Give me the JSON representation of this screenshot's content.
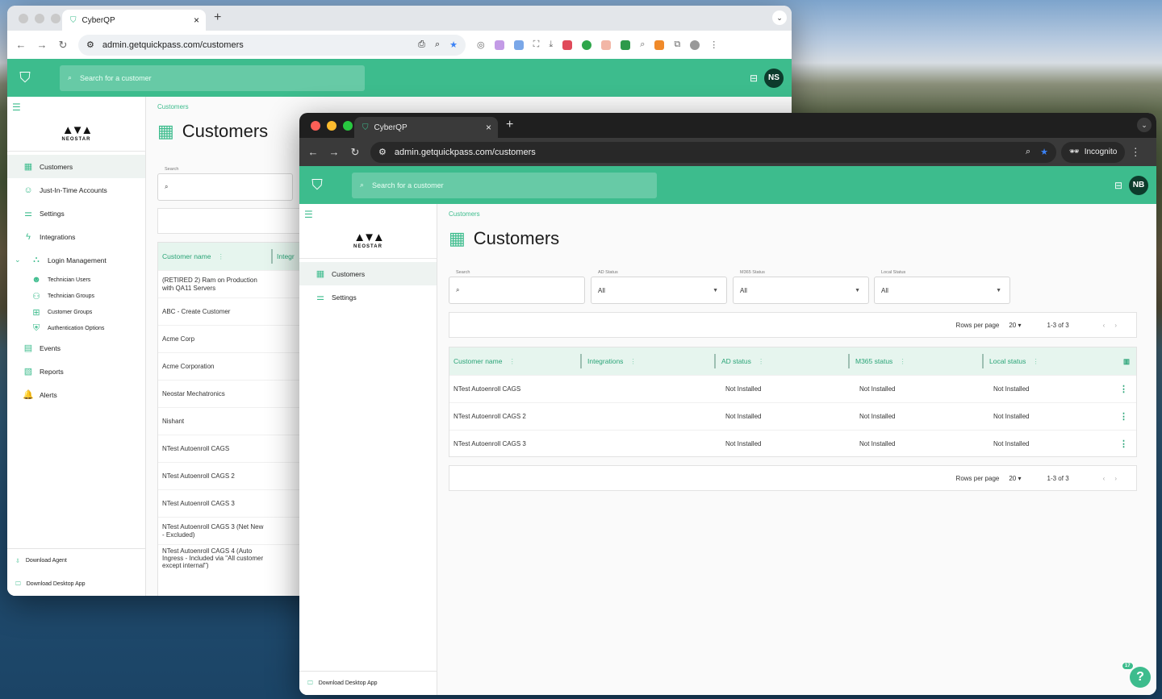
{
  "back_window": {
    "tab_title": "CyberQP",
    "url": "admin.getquickpass.com/customers",
    "search_placeholder": "Search for a customer",
    "avatar": "NS",
    "brand": "NEOSTAR",
    "nav": [
      {
        "label": "Customers",
        "icon": "building-icon",
        "active": true
      },
      {
        "label": "Just-In-Time Accounts",
        "icon": "users-icon"
      },
      {
        "label": "Settings",
        "icon": "settings-icon"
      },
      {
        "label": "Integrations",
        "icon": "bolt-icon"
      },
      {
        "label": "Login Management",
        "icon": "login-icon",
        "expanded": true
      },
      {
        "label": "Technician Users",
        "icon": "user-icon",
        "sub": true
      },
      {
        "label": "Technician Groups",
        "icon": "group-icon",
        "sub": true
      },
      {
        "label": "Customer Groups",
        "icon": "org-icon",
        "sub": true
      },
      {
        "label": "Authentication Options",
        "icon": "shield-icon",
        "sub": true
      },
      {
        "label": "Events",
        "icon": "calendar-icon"
      },
      {
        "label": "Reports",
        "icon": "report-icon"
      },
      {
        "label": "Alerts",
        "icon": "bell-icon"
      }
    ],
    "footer": [
      {
        "label": "Download Agent"
      },
      {
        "label": "Download Desktop App"
      }
    ],
    "breadcrumb": "Customers",
    "title": "Customers",
    "search_label": "Search",
    "columns": [
      "Customer name",
      "Integr"
    ],
    "customers": [
      "(RETIRED 2) Ram on Production with QA11 Servers",
      "ABC - Create Customer",
      "Acme Corp",
      "Acme Corporation",
      "Neostar Mechatronics",
      "Nishant",
      "NTest Autoenroll CAGS",
      "NTest Autoenroll CAGS 2",
      "NTest Autoenroll CAGS 3",
      "NTest Autoenroll CAGS 3 (Net New - Excluded)",
      "NTest Autoenroll CAGS 4 (Auto Ingress - Included via \"All customer except internal\")"
    ]
  },
  "front_window": {
    "tab_title": "CyberQP",
    "url": "admin.getquickpass.com/customers",
    "incognito": "Incognito",
    "search_placeholder": "Search for a customer",
    "avatar": "NB",
    "brand": "NEOSTAR",
    "nav": [
      {
        "label": "Customers",
        "active": true
      },
      {
        "label": "Settings"
      }
    ],
    "footer": "Download Desktop App",
    "breadcrumb": "Customers",
    "title": "Customers",
    "filters": {
      "search_label": "Search",
      "ad_label": "AD Status",
      "ad_value": "All",
      "m365_label": "M365 Status",
      "m365_value": "All",
      "local_label": "Local Status",
      "local_value": "All"
    },
    "pagination": {
      "rows_label": "Rows per page",
      "rows_value": "20",
      "range": "1-3 of 3"
    },
    "columns": [
      "Customer name",
      "Integrations",
      "AD status",
      "M365 status",
      "Local status"
    ],
    "rows": [
      {
        "name": "NTest Autoenroll CAGS",
        "integrations": "",
        "ad": "Not Installed",
        "m365": "Not Installed",
        "local": "Not Installed"
      },
      {
        "name": "NTest Autoenroll CAGS 2",
        "integrations": "",
        "ad": "Not Installed",
        "m365": "Not Installed",
        "local": "Not Installed"
      },
      {
        "name": "NTest Autoenroll CAGS 3",
        "integrations": "",
        "ad": "Not Installed",
        "m365": "Not Installed",
        "local": "Not Installed"
      }
    ],
    "help_badge": "17",
    "help_label": "?"
  },
  "colors": {
    "brand_green": "#3dbc8d",
    "avatar_bg": "#0d3b2c"
  }
}
